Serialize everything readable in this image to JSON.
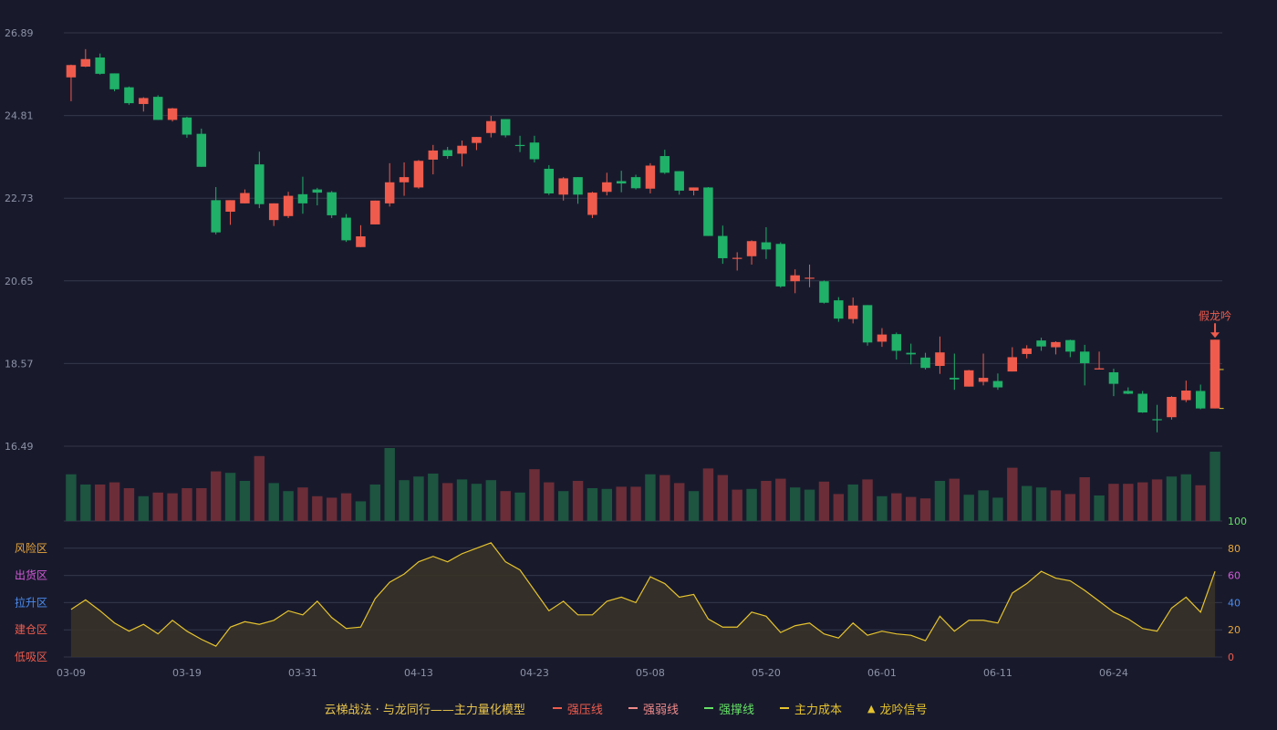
{
  "colors": {
    "background": "#181a2c",
    "up": "#ef5b4c",
    "down": "#20b068",
    "up_volume": "#6b2d38",
    "down_volume": "#1d5540",
    "grid": "#333749",
    "axis_text": "#8d92a6",
    "line": "#e6c32e",
    "signal": "#ef5b4c"
  },
  "chart_data": {
    "type": "candlestick",
    "title": "",
    "price_axis": {
      "min": 16.49,
      "max": 26.89,
      "ticks": [
        "26.89",
        "24.81",
        "22.73",
        "20.65",
        "18.57",
        "16.49"
      ]
    },
    "indicator_axis": {
      "min": 0,
      "max": 100,
      "ticks": [
        "100",
        "80",
        "60",
        "40",
        "20",
        "0"
      ]
    },
    "zones": [
      {
        "label": "风险区",
        "color": "#e8a53c",
        "level": 80
      },
      {
        "label": "出货区",
        "color": "#d45ad8",
        "level": 60
      },
      {
        "label": "拉升区",
        "color": "#4c8cf0",
        "level": 40
      },
      {
        "label": "建仓区",
        "color": "#ef5b4c",
        "level": 20
      },
      {
        "label": "低吸区",
        "color": "#ef5b4c",
        "level": 0
      }
    ],
    "x_labels": [
      {
        "index": 0,
        "label": "03-09"
      },
      {
        "index": 8,
        "label": "03-19"
      },
      {
        "index": 16,
        "label": "03-31"
      },
      {
        "index": 24,
        "label": "04-13"
      },
      {
        "index": 32,
        "label": "04-23"
      },
      {
        "index": 40,
        "label": "05-08"
      },
      {
        "index": 48,
        "label": "05-20"
      },
      {
        "index": 56,
        "label": "06-01"
      },
      {
        "index": 64,
        "label": "06-11"
      },
      {
        "index": 72,
        "label": "06-24"
      }
    ],
    "candles": [
      [
        25.77,
        26.08,
        25.17,
        26.09
      ],
      [
        26.04,
        26.23,
        26.03,
        26.48
      ],
      [
        26.27,
        25.86,
        25.84,
        26.37
      ],
      [
        25.87,
        25.47,
        25.42,
        25.87
      ],
      [
        25.52,
        25.12,
        25.08,
        25.54
      ],
      [
        25.1,
        25.25,
        24.91,
        25.27
      ],
      [
        25.28,
        24.7,
        24.7,
        25.32
      ],
      [
        24.7,
        24.99,
        24.66,
        25.0
      ],
      [
        24.76,
        24.33,
        24.25,
        24.78
      ],
      [
        24.35,
        23.52,
        23.52,
        24.48
      ],
      [
        22.68,
        21.87,
        21.82,
        23.01
      ],
      [
        22.39,
        22.68,
        22.06,
        22.68
      ],
      [
        22.6,
        22.86,
        22.6,
        22.95
      ],
      [
        23.58,
        22.58,
        22.48,
        23.9
      ],
      [
        22.18,
        22.6,
        22.03,
        22.6
      ],
      [
        22.28,
        22.79,
        22.23,
        22.89
      ],
      [
        22.83,
        22.6,
        22.34,
        23.27
      ],
      [
        22.95,
        22.87,
        22.55,
        22.99
      ],
      [
        22.88,
        22.3,
        22.23,
        22.91
      ],
      [
        22.24,
        21.67,
        21.63,
        22.33
      ],
      [
        21.5,
        21.77,
        21.5,
        22.05
      ],
      [
        22.07,
        22.67,
        22.07,
        22.67
      ],
      [
        22.6,
        23.13,
        22.52,
        23.61
      ],
      [
        23.13,
        23.26,
        22.79,
        23.63
      ],
      [
        23.0,
        23.67,
        22.97,
        23.69
      ],
      [
        23.7,
        23.93,
        23.33,
        24.07
      ],
      [
        23.94,
        23.79,
        23.72,
        24.02
      ],
      [
        23.85,
        24.05,
        23.53,
        24.18
      ],
      [
        24.12,
        24.27,
        23.94,
        24.27
      ],
      [
        24.37,
        24.67,
        24.26,
        24.8
      ],
      [
        24.72,
        24.31,
        24.26,
        24.72
      ],
      [
        24.07,
        24.06,
        23.89,
        24.3
      ],
      [
        24.13,
        23.71,
        23.63,
        24.3
      ],
      [
        23.47,
        22.85,
        22.81,
        23.56
      ],
      [
        22.82,
        23.23,
        22.67,
        23.26
      ],
      [
        23.26,
        22.82,
        22.59,
        23.26
      ],
      [
        22.31,
        22.87,
        22.23,
        22.89
      ],
      [
        22.89,
        23.13,
        22.8,
        23.37
      ],
      [
        23.16,
        23.1,
        22.88,
        23.42
      ],
      [
        23.26,
        22.98,
        22.95,
        23.32
      ],
      [
        22.97,
        23.55,
        22.85,
        23.61
      ],
      [
        23.79,
        23.37,
        23.34,
        23.95
      ],
      [
        23.41,
        22.92,
        22.82,
        23.41
      ],
      [
        22.92,
        23.0,
        22.8,
        23.0
      ],
      [
        23.0,
        21.78,
        21.78,
        23.01
      ],
      [
        21.78,
        21.22,
        21.08,
        22.04
      ],
      [
        21.22,
        21.23,
        20.91,
        21.37
      ],
      [
        21.27,
        21.65,
        21.06,
        21.67
      ],
      [
        21.62,
        21.44,
        21.2,
        22.0
      ],
      [
        21.58,
        20.51,
        20.48,
        21.62
      ],
      [
        20.64,
        20.79,
        20.34,
        20.94
      ],
      [
        20.72,
        20.73,
        20.49,
        21.06
      ],
      [
        20.64,
        20.1,
        20.08,
        20.66
      ],
      [
        20.16,
        19.7,
        19.62,
        20.24
      ],
      [
        19.69,
        20.03,
        19.58,
        20.23
      ],
      [
        20.04,
        19.1,
        19.02,
        20.04
      ],
      [
        19.12,
        19.3,
        18.99,
        19.46
      ],
      [
        19.31,
        18.89,
        18.67,
        19.35
      ],
      [
        18.84,
        18.8,
        18.55,
        19.07
      ],
      [
        18.72,
        18.46,
        18.42,
        18.84
      ],
      [
        18.51,
        18.85,
        18.31,
        19.25
      ],
      [
        18.21,
        18.17,
        17.91,
        18.82
      ],
      [
        17.99,
        18.4,
        17.99,
        18.41
      ],
      [
        18.11,
        18.21,
        18.02,
        18.82
      ],
      [
        18.13,
        17.97,
        17.91,
        18.32
      ],
      [
        18.37,
        18.73,
        18.37,
        18.98
      ],
      [
        18.81,
        18.95,
        18.7,
        19.03
      ],
      [
        19.15,
        19.0,
        18.89,
        19.22
      ],
      [
        18.98,
        19.11,
        18.8,
        19.13
      ],
      [
        19.16,
        18.87,
        18.73,
        19.17
      ],
      [
        18.87,
        18.58,
        18.02,
        19.04
      ],
      [
        18.42,
        18.45,
        18.44,
        18.87
      ],
      [
        18.35,
        18.06,
        17.75,
        18.44
      ],
      [
        17.88,
        17.81,
        17.8,
        17.97
      ],
      [
        17.81,
        17.34,
        17.33,
        17.88
      ],
      [
        17.17,
        17.15,
        16.84,
        17.53
      ],
      [
        17.22,
        17.73,
        17.16,
        17.75
      ],
      [
        17.65,
        17.89,
        17.6,
        18.14
      ],
      [
        17.88,
        17.44,
        17.42,
        18.04
      ],
      [
        17.44,
        19.17,
        17.44,
        19.17
      ]
    ],
    "volume_bars": [
      0.64,
      0.5,
      0.5,
      0.53,
      0.45,
      0.34,
      0.39,
      0.38,
      0.45,
      0.45,
      0.68,
      0.66,
      0.55,
      0.89,
      0.52,
      0.41,
      0.46,
      0.34,
      0.32,
      0.38,
      0.27,
      0.5,
      1.0,
      0.56,
      0.61,
      0.65,
      0.52,
      0.57,
      0.51,
      0.56,
      0.41,
      0.39,
      0.71,
      0.53,
      0.41,
      0.55,
      0.45,
      0.44,
      0.47,
      0.47,
      0.64,
      0.63,
      0.52,
      0.41,
      0.72,
      0.63,
      0.43,
      0.44,
      0.55,
      0.58,
      0.46,
      0.43,
      0.54,
      0.37,
      0.5,
      0.57,
      0.34,
      0.38,
      0.33,
      0.31,
      0.55,
      0.58,
      0.36,
      0.42,
      0.32,
      0.73,
      0.48,
      0.46,
      0.42,
      0.37,
      0.6,
      0.35,
      0.51,
      0.51,
      0.53,
      0.57,
      0.61,
      0.64,
      0.49,
      0.95
    ],
    "volume_colors": [
      "d",
      "d",
      "u",
      "u",
      "u",
      "d",
      "u",
      "u",
      "u",
      "u",
      "u",
      "d",
      "d",
      "u",
      "d",
      "d",
      "u",
      "u",
      "u",
      "u",
      "d",
      "d",
      "d",
      "d",
      "d",
      "d",
      "u",
      "d",
      "d",
      "d",
      "u",
      "d",
      "u",
      "u",
      "d",
      "u",
      "d",
      "d",
      "u",
      "u",
      "d",
      "u",
      "u",
      "d",
      "u",
      "u",
      "u",
      "d",
      "u",
      "u",
      "d",
      "d",
      "u",
      "u",
      "d",
      "u",
      "d",
      "u",
      "u",
      "u",
      "d",
      "u",
      "d",
      "d",
      "d",
      "u",
      "d",
      "d",
      "u",
      "u",
      "u",
      "d",
      "u",
      "u",
      "u",
      "u",
      "d",
      "d",
      "u",
      "d"
    ],
    "indicator_values": [
      35,
      42,
      34,
      25,
      19,
      24,
      17,
      27,
      19,
      13,
      8,
      22,
      26,
      24,
      27,
      34,
      31,
      41,
      29,
      21,
      22,
      43,
      55,
      61,
      70,
      74,
      70,
      76,
      80,
      84,
      70,
      64,
      49,
      34,
      41,
      31,
      31,
      41,
      44,
      40,
      59,
      54,
      44,
      46,
      28,
      22,
      22,
      33,
      30,
      18,
      23,
      25,
      17,
      14,
      25,
      16,
      19,
      17,
      16,
      12,
      30,
      19,
      27,
      27,
      25,
      47,
      54,
      63,
      58,
      56,
      49,
      41,
      33,
      28,
      21,
      19,
      36,
      44,
      33,
      63
    ],
    "signal": {
      "index": 79,
      "label": "假龙吟"
    }
  },
  "legend": {
    "title": "云梯战法 · 与龙同行——主力量化模型",
    "items": [
      {
        "label": "强压线",
        "color": "#ef5b4c",
        "style": "solid"
      },
      {
        "label": "强弱线",
        "color": "#ef8a8a",
        "style": "dashed"
      },
      {
        "label": "强撑线",
        "color": "#66e066",
        "style": "solid"
      },
      {
        "label": "主力成本",
        "color": "#e6c32e",
        "style": "dashed"
      },
      {
        "label": "龙吟信号",
        "color": "#e6c32e",
        "style": "triangle"
      }
    ]
  }
}
